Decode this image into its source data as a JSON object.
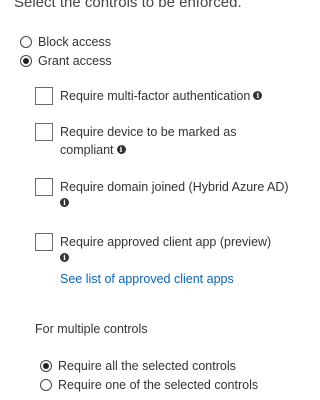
{
  "heading": "Select the controls to be enforced.",
  "access_options": [
    {
      "label": "Block access",
      "selected": false
    },
    {
      "label": "Grant access",
      "selected": true
    }
  ],
  "controls": [
    {
      "label": "Require multi-factor authentication",
      "checked": false
    },
    {
      "label": "Require device to be marked as compliant",
      "checked": false
    },
    {
      "label": "Require domain joined (Hybrid Azure AD)",
      "checked": false
    },
    {
      "label": "Require approved client app (preview)",
      "checked": false
    }
  ],
  "approved_apps_link": "See list of approved client apps",
  "multiple_controls": {
    "label": "For multiple controls",
    "options": [
      {
        "label": "Require all the selected controls",
        "selected": true
      },
      {
        "label": "Require one of the selected controls",
        "selected": false
      }
    ]
  },
  "icons": {
    "info": "info-icon",
    "info_glyph": "i"
  }
}
